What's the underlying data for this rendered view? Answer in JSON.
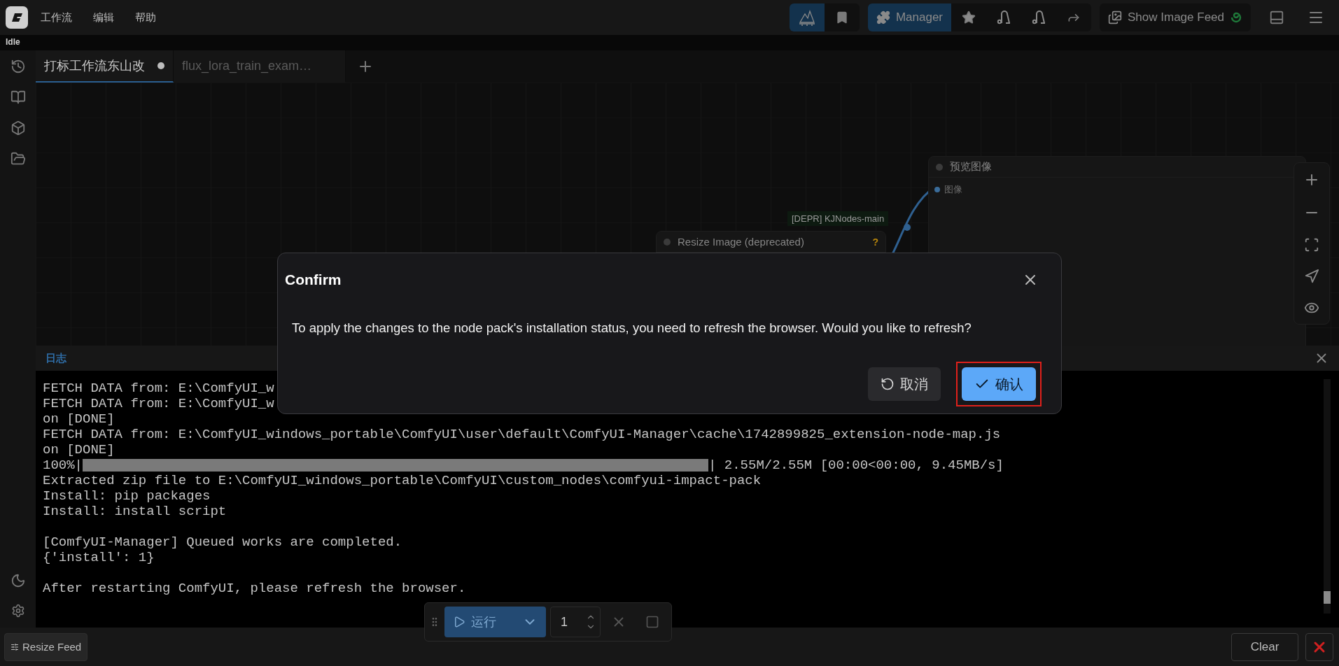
{
  "menu_bar": {
    "items": [
      "工作流",
      "编辑",
      "帮助"
    ]
  },
  "status": "Idle",
  "toolbar": {
    "manager": "Manager",
    "image_feed": "Show Image Feed"
  },
  "tabs": [
    {
      "label": "打标工作流东山改",
      "selected": true,
      "modified": true
    },
    {
      "label": "flux_lora_train_exam…",
      "selected": false,
      "modified": false
    }
  ],
  "canvas": {
    "group_label": "[DEPR] KJNodes-main",
    "nodes": [
      {
        "title": "预览图像",
        "inputs": [
          "图像"
        ]
      },
      {
        "title": "Resize Image (deprecated)",
        "badge": "?"
      }
    ]
  },
  "log_panel": {
    "title": "日志",
    "lines": [
      {
        "kind": "text",
        "text": "FETCH DATA from: E:\\ComfyUI_w"
      },
      {
        "kind": "text",
        "text": "FETCH DATA from: E:\\ComfyUI_w"
      },
      {
        "kind": "text",
        "text": "on [DONE]"
      },
      {
        "kind": "text",
        "text": "FETCH DATA from: E:\\ComfyUI_windows_portable\\ComfyUI\\user\\default\\ComfyUI-Manager\\cache\\1742899825_extension-node-map.js"
      },
      {
        "kind": "text",
        "text": "on [DONE]"
      },
      {
        "kind": "progress",
        "prefix": "100%|",
        "suffix": "| 2.55M/2.55M [00:00<00:00, 9.45MB/s]",
        "level": 1
      },
      {
        "kind": "text",
        "text": "Extracted zip file to E:\\ComfyUI_windows_portable\\ComfyUI\\custom_nodes\\comfyui-impact-pack"
      },
      {
        "kind": "text",
        "text": "Install: pip packages"
      },
      {
        "kind": "text",
        "text": "Install: install script"
      },
      {
        "kind": "gap"
      },
      {
        "kind": "text",
        "text": "[ComfyUI-Manager] Queued works are completed."
      },
      {
        "kind": "text",
        "text": "{'install': 1}"
      },
      {
        "kind": "gap"
      },
      {
        "kind": "text",
        "text": "After restarting ComfyUI, please refresh the browser."
      }
    ]
  },
  "dialog": {
    "title": "Confirm",
    "message": "To apply the changes to the node pack's installation status, you need to refresh the browser. Would you like to refresh?",
    "buttons": [
      {
        "kind": "cancel",
        "label": "取消",
        "highlighted": false
      },
      {
        "kind": "confirm",
        "label": "确认",
        "highlighted": true
      }
    ]
  },
  "run_bar": {
    "run_label": "运行",
    "count": "1"
  },
  "bottom_bar": {
    "resize_feed": "Resize Feed",
    "clear": "Clear"
  }
}
